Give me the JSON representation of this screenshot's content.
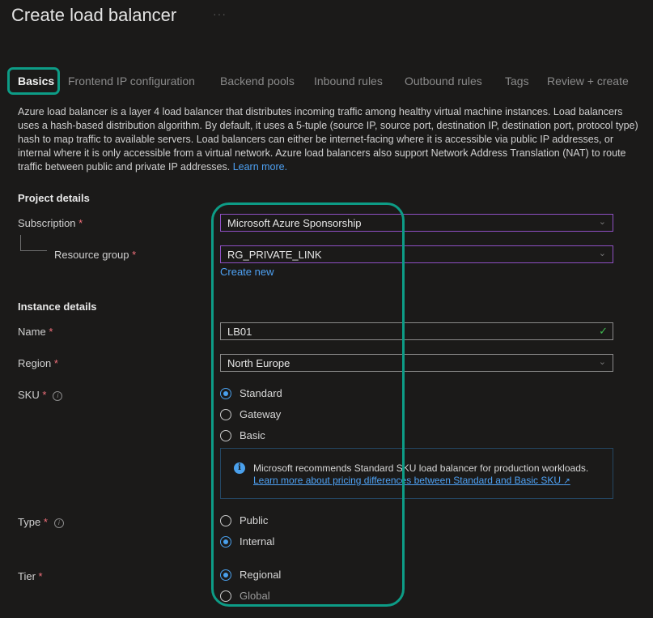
{
  "header": {
    "title": "Create load balancer",
    "more": "···"
  },
  "tabs": [
    {
      "label": "Basics"
    },
    {
      "label": "Frontend IP configuration"
    },
    {
      "label": "Backend pools"
    },
    {
      "label": "Inbound rules"
    },
    {
      "label": "Outbound rules"
    },
    {
      "label": "Tags"
    },
    {
      "label": "Review + create"
    }
  ],
  "description": {
    "text": "Azure load balancer is a layer 4 load balancer that distributes incoming traffic among healthy virtual machine instances. Load balancers uses a hash-based distribution algorithm. By default, it uses a 5-tuple (source IP, source port, destination IP, destination port, protocol type) hash to map traffic to available servers. Load balancers can either be internet-facing where it is accessible via public IP addresses, or internal where it is only accessible from a virtual network. Azure load balancers also support Network Address Translation (NAT) to route traffic between public and private IP addresses.",
    "link": "Learn more."
  },
  "project": {
    "heading": "Project details",
    "subscription": {
      "label": "Subscription",
      "value": "Microsoft Azure Sponsorship"
    },
    "resource_group": {
      "label": "Resource group",
      "value": "RG_PRIVATE_LINK",
      "create_new": "Create new"
    }
  },
  "instance": {
    "heading": "Instance details",
    "name": {
      "label": "Name",
      "value": "LB01"
    },
    "region": {
      "label": "Region",
      "value": "North Europe"
    },
    "sku": {
      "label": "SKU",
      "options": [
        "Standard",
        "Gateway",
        "Basic"
      ],
      "selected": "Standard",
      "notice_text": "Microsoft recommends Standard SKU load balancer for production workloads.",
      "notice_link": "Learn more about pricing differences between Standard and Basic SKU"
    },
    "type": {
      "label": "Type",
      "options": [
        "Public",
        "Internal"
      ],
      "selected": "Internal"
    },
    "tier": {
      "label": "Tier",
      "options": [
        "Regional",
        "Global"
      ],
      "selected": "Regional"
    }
  },
  "required_marker": "*",
  "colors": {
    "accent": "#4aa0ec",
    "highlight": "#0d9c86",
    "required": "#f1707b",
    "valid": "#3fb950"
  }
}
